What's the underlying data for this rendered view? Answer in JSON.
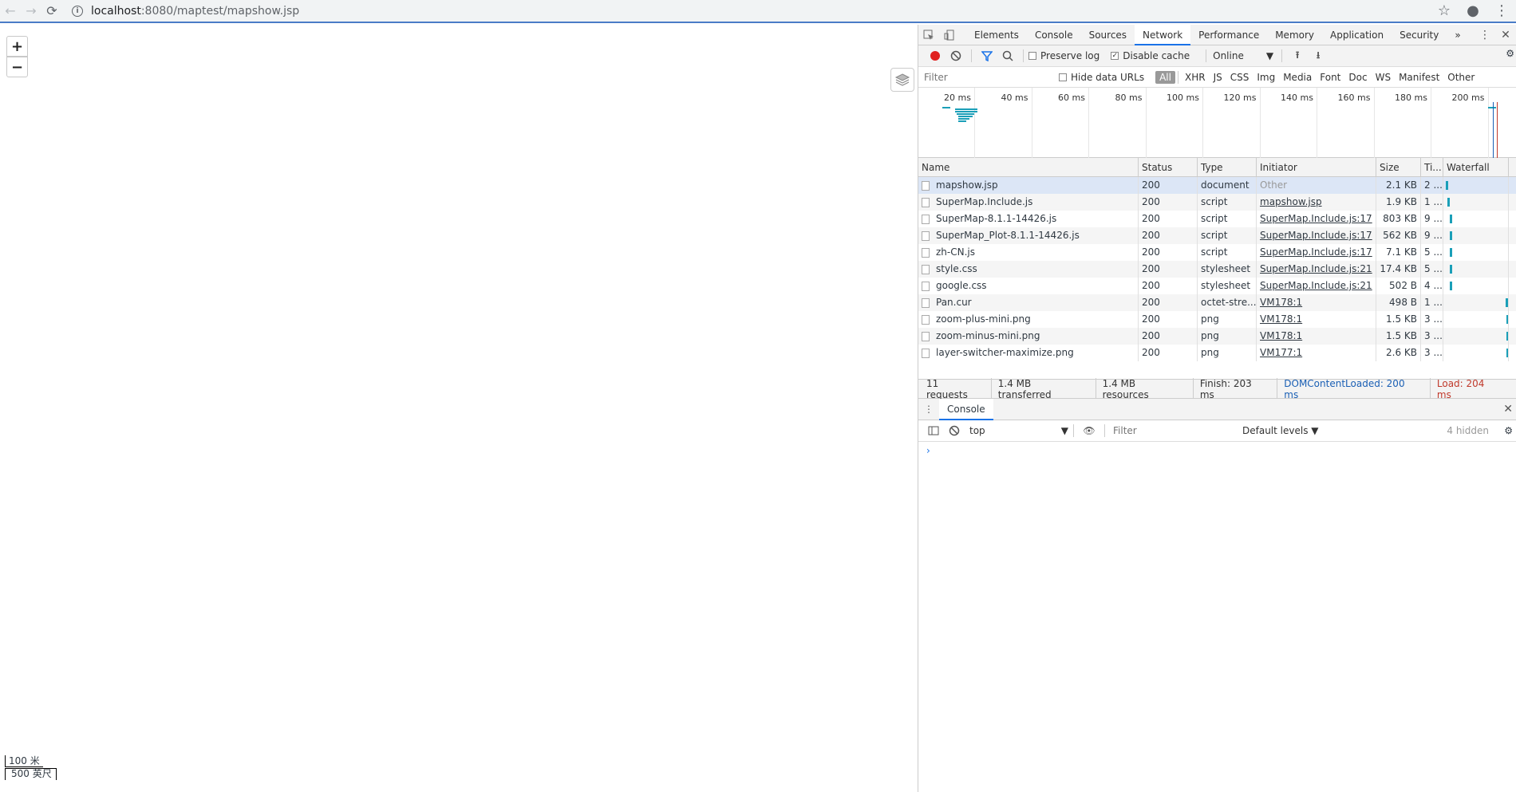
{
  "browser": {
    "url_host": "localhost",
    "url_path": ":8080/maptest/mapshow.jsp"
  },
  "map": {
    "zoom_in": "+",
    "zoom_out": "−",
    "scale_metric": "100 米",
    "scale_imperial": "500 英尺"
  },
  "devtools": {
    "tabs": [
      "Elements",
      "Console",
      "Sources",
      "Network",
      "Performance",
      "Memory",
      "Application",
      "Security"
    ],
    "more_tabs": "»",
    "toolbar": {
      "preserve_log": "Preserve log",
      "disable_cache": "Disable cache",
      "throttle": "Online"
    },
    "filter": {
      "placeholder": "Filter",
      "hide_data_urls": "Hide data URLs",
      "types": [
        "All",
        "XHR",
        "JS",
        "CSS",
        "Img",
        "Media",
        "Font",
        "Doc",
        "WS",
        "Manifest",
        "Other"
      ]
    },
    "overview_ticks": [
      "20 ms",
      "40 ms",
      "60 ms",
      "80 ms",
      "100 ms",
      "120 ms",
      "140 ms",
      "160 ms",
      "180 ms",
      "200 ms"
    ],
    "columns": [
      "Name",
      "Status",
      "Type",
      "Initiator",
      "Size",
      "Ti...",
      "Waterfall"
    ],
    "requests": [
      {
        "name": "mapshow.jsp",
        "status": "200",
        "type": "document",
        "initiator": "Other",
        "size": "2.1 KB",
        "time": "2 ..."
      },
      {
        "name": "SuperMap.Include.js",
        "status": "200",
        "type": "script",
        "initiator": "mapshow.jsp",
        "size": "1.9 KB",
        "time": "1 ..."
      },
      {
        "name": "SuperMap-8.1.1-14426.js",
        "status": "200",
        "type": "script",
        "initiator": "SuperMap.Include.js:17",
        "size": "803 KB",
        "time": "9 ..."
      },
      {
        "name": "SuperMap_Plot-8.1.1-14426.js",
        "status": "200",
        "type": "script",
        "initiator": "SuperMap.Include.js:17",
        "size": "562 KB",
        "time": "9 ..."
      },
      {
        "name": "zh-CN.js",
        "status": "200",
        "type": "script",
        "initiator": "SuperMap.Include.js:17",
        "size": "7.1 KB",
        "time": "5 ..."
      },
      {
        "name": "style.css",
        "status": "200",
        "type": "stylesheet",
        "initiator": "SuperMap.Include.js:21",
        "size": "17.4 KB",
        "time": "5 ..."
      },
      {
        "name": "google.css",
        "status": "200",
        "type": "stylesheet",
        "initiator": "SuperMap.Include.js:21",
        "size": "502 B",
        "time": "4 ..."
      },
      {
        "name": "Pan.cur",
        "status": "200",
        "type": "octet-stre...",
        "initiator": "VM178:1",
        "size": "498 B",
        "time": "1 ..."
      },
      {
        "name": "zoom-plus-mini.png",
        "status": "200",
        "type": "png",
        "initiator": "VM178:1",
        "size": "1.5 KB",
        "time": "3 ..."
      },
      {
        "name": "zoom-minus-mini.png",
        "status": "200",
        "type": "png",
        "initiator": "VM178:1",
        "size": "1.5 KB",
        "time": "3 ..."
      },
      {
        "name": "layer-switcher-maximize.png",
        "status": "200",
        "type": "png",
        "initiator": "VM177:1",
        "size": "2.6 KB",
        "time": "3 ..."
      }
    ],
    "summary": {
      "requests": "11 requests",
      "transferred": "1.4 MB transferred",
      "resources": "1.4 MB resources",
      "finish": "Finish: 203 ms",
      "dcl": "DOMContentLoaded: 200 ms",
      "load": "Load: 204 ms"
    },
    "console": {
      "tab": "Console",
      "context": "top",
      "filter_placeholder": "Filter",
      "levels": "Default levels ▼",
      "hidden": "4 hidden",
      "prompt": "›"
    }
  },
  "colors": {
    "accent": "#1a73e8",
    "waterfall": "#1a9fb8",
    "record": "#e0201e"
  }
}
